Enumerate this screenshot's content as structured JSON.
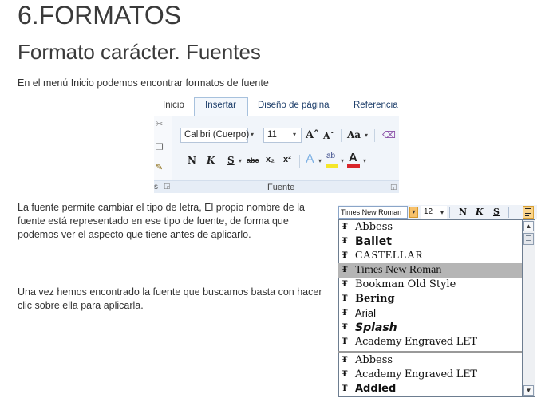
{
  "heading": "6.FORMATOS",
  "subheading": "Formato carácter. Fuentes",
  "intro": "En el menú Inicio podemos encontrar formatos de fuente",
  "ribbon": {
    "tabs": [
      "Inicio",
      "Insertar",
      "Diseño de página",
      "Referencia"
    ],
    "font_name": "Calibri (Cuerpo)",
    "font_size": "11",
    "grow_icon": "Aˆ",
    "shrink_icon": "Aˇ",
    "case_label": "Aa",
    "bold": "N",
    "italic": "K",
    "underline": "S",
    "strike": "abc",
    "subscript": "x₂",
    "superscript": "x²",
    "effects": "A",
    "highlight": "ab",
    "fontcolor": "A",
    "group_label": "Fuente",
    "left_label": "s",
    "accent_color": "#1e3f6b",
    "highlight_color": "#f5e62a",
    "fontcolor_color": "#d9262b"
  },
  "paragraph1": "La fuente permite cambiar el tipo de letra, El propio nombre de la fuente está representado en ese tipo de fuente, de forma que podemos ver el aspecto que tiene antes de aplicarlo.",
  "paragraph2": "Una vez hemos encontrado la fuente que buscamos basta con hacer clic sobre ella para aplicarla.",
  "font_dropdown": {
    "current_font": "Times New Roman",
    "size": "12",
    "bold": "N",
    "italic": "K",
    "underline": "S",
    "tt_glyph": "Ŧ",
    "recent_fonts": [
      "Abbess",
      "Ballet",
      "CASTELLAR",
      "Times New Roman",
      "Bookman Old Style",
      "Bering",
      "Arial",
      "Splash",
      "Academy Engraved LET"
    ],
    "all_fonts": [
      "Abbess",
      "Academy Engraved LET",
      "Addled"
    ],
    "selected_font": "Times New Roman"
  }
}
